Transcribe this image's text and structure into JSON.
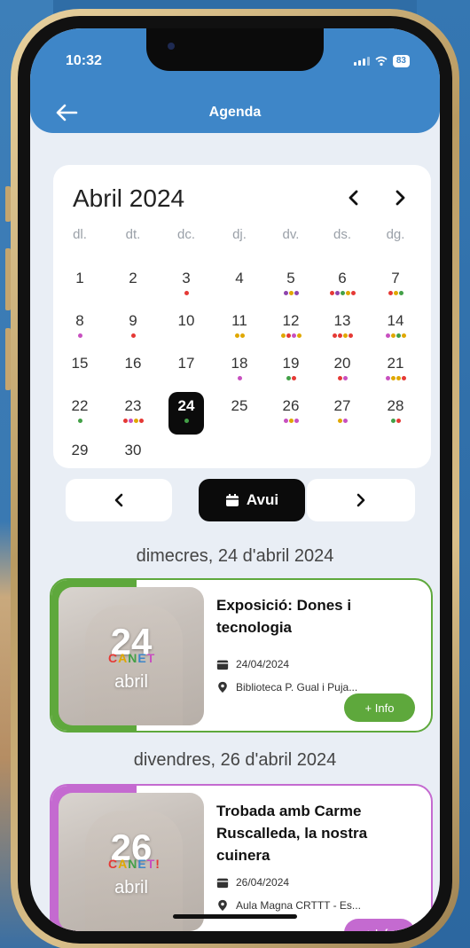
{
  "status": {
    "time": "10:32",
    "battery": "83"
  },
  "header": {
    "title": "Agenda"
  },
  "calendar": {
    "month_title": "Abril 2024",
    "weekdays": [
      "dl.",
      "dt.",
      "dc.",
      "dj.",
      "dv.",
      "ds.",
      "dg."
    ],
    "days": [
      {
        "n": "1",
        "col": 0,
        "row": 0,
        "dots": []
      },
      {
        "n": "2",
        "col": 1,
        "row": 0,
        "dots": []
      },
      {
        "n": "3",
        "col": 2,
        "row": 0,
        "dots": [
          "#e53935"
        ]
      },
      {
        "n": "4",
        "col": 3,
        "row": 0,
        "dots": []
      },
      {
        "n": "5",
        "col": 4,
        "row": 0,
        "dots": [
          "#8e44ad",
          "#e0a800",
          "#8e44ad"
        ]
      },
      {
        "n": "6",
        "col": 5,
        "row": 0,
        "dots": [
          "#e53935",
          "#8e44ad",
          "#43a047",
          "#e0a800",
          "#e53935"
        ]
      },
      {
        "n": "7",
        "col": 6,
        "row": 0,
        "dots": [
          "#e53935",
          "#e0a800",
          "#43a047"
        ]
      },
      {
        "n": "8",
        "col": 0,
        "row": 1,
        "dots": [
          "#c850c0"
        ]
      },
      {
        "n": "9",
        "col": 1,
        "row": 1,
        "dots": [
          "#e53935"
        ]
      },
      {
        "n": "10",
        "col": 2,
        "row": 1,
        "dots": []
      },
      {
        "n": "11",
        "col": 3,
        "row": 1,
        "dots": [
          "#e0a800",
          "#e0a800"
        ]
      },
      {
        "n": "12",
        "col": 4,
        "row": 1,
        "dots": [
          "#e0a800",
          "#e53935",
          "#c850c0",
          "#e0a800"
        ]
      },
      {
        "n": "13",
        "col": 5,
        "row": 1,
        "dots": [
          "#e53935",
          "#e53935",
          "#e0a800",
          "#e53935"
        ]
      },
      {
        "n": "14",
        "col": 6,
        "row": 1,
        "dots": [
          "#c850c0",
          "#e0a800",
          "#43a047",
          "#e0a800"
        ]
      },
      {
        "n": "15",
        "col": 0,
        "row": 2,
        "dots": []
      },
      {
        "n": "16",
        "col": 1,
        "row": 2,
        "dots": []
      },
      {
        "n": "17",
        "col": 2,
        "row": 2,
        "dots": []
      },
      {
        "n": "18",
        "col": 3,
        "row": 2,
        "dots": [
          "#c850c0"
        ]
      },
      {
        "n": "19",
        "col": 4,
        "row": 2,
        "dots": [
          "#43a047",
          "#e53935"
        ]
      },
      {
        "n": "20",
        "col": 5,
        "row": 2,
        "dots": [
          "#e53935",
          "#c850c0"
        ]
      },
      {
        "n": "21",
        "col": 6,
        "row": 2,
        "dots": [
          "#c850c0",
          "#e0a800",
          "#e0a800",
          "#e53935"
        ]
      },
      {
        "n": "22",
        "col": 0,
        "row": 3,
        "dots": [
          "#43a047"
        ]
      },
      {
        "n": "23",
        "col": 1,
        "row": 3,
        "dots": [
          "#e53935",
          "#c850c0",
          "#e0a800",
          "#e53935"
        ]
      },
      {
        "n": "24",
        "col": 2,
        "row": 3,
        "dots": [
          "#43a047"
        ],
        "selected": true
      },
      {
        "n": "25",
        "col": 3,
        "row": 3,
        "dots": []
      },
      {
        "n": "26",
        "col": 4,
        "row": 3,
        "dots": [
          "#c850c0",
          "#e0a800",
          "#c850c0"
        ]
      },
      {
        "n": "27",
        "col": 5,
        "row": 3,
        "dots": [
          "#e0a800",
          "#c850c0"
        ]
      },
      {
        "n": "28",
        "col": 6,
        "row": 3,
        "dots": [
          "#43a047",
          "#e53935"
        ]
      },
      {
        "n": "29",
        "col": 0,
        "row": 4,
        "dots": []
      },
      {
        "n": "30",
        "col": 1,
        "row": 4,
        "dots": []
      }
    ]
  },
  "nav": {
    "today_label": "Avui"
  },
  "sections": [
    {
      "heading": "dimecres, 24 d'abril 2024",
      "event": {
        "title": "Exposició: Dones i tecnologia",
        "date": "24/04/2024",
        "location": "Biblioteca P. Gual i Puja...",
        "thumb_day": "24",
        "thumb_month": "abril",
        "thumb_logo": "CANET",
        "info_label": "+ Info",
        "color": "#5ea83c"
      }
    },
    {
      "heading": "divendres, 26 d'abril 2024",
      "event": {
        "title": "Trobada amb Carme Ruscalleda, la nostra cuinera",
        "date": "26/04/2024",
        "location": "Aula Magna CRTTT - Es...",
        "thumb_day": "26",
        "thumb_month": "abril",
        "thumb_logo": "CANET!",
        "info_label": "+ Info",
        "color": "#c46ad0"
      }
    }
  ],
  "icons": {
    "back": "arrow-left-icon",
    "prev": "chevron-left-icon",
    "next": "chevron-right-icon",
    "calendar": "calendar-icon",
    "location": "location-pin-icon"
  }
}
